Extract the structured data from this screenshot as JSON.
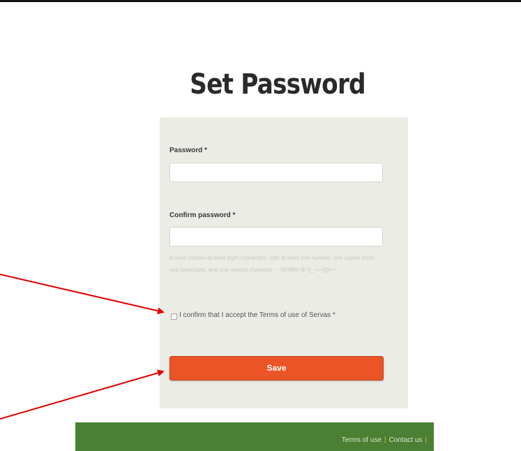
{
  "page": {
    "title": "Set Password"
  },
  "form": {
    "password_label": "Password *",
    "password_value": "",
    "confirm_label": "Confirm password *",
    "confirm_value": "",
    "hint": "It must contain at least eight characters, with at least one number, one capital letter, one lowercase, and one special character : ~!@#$%^&*()_+=-{}[]<>",
    "terms_checked": false,
    "terms_label": "I confirm that I accept the Terms of use of Servas *",
    "save_label": "Save"
  },
  "footer": {
    "links": [
      {
        "label": "Terms of use"
      },
      {
        "label": "Contact us"
      }
    ],
    "separator": "|"
  },
  "colors": {
    "panel": "#ebece6",
    "save_button": "#ea5427",
    "footer": "#4b7f33",
    "annotation_arrow": "#e00000"
  }
}
